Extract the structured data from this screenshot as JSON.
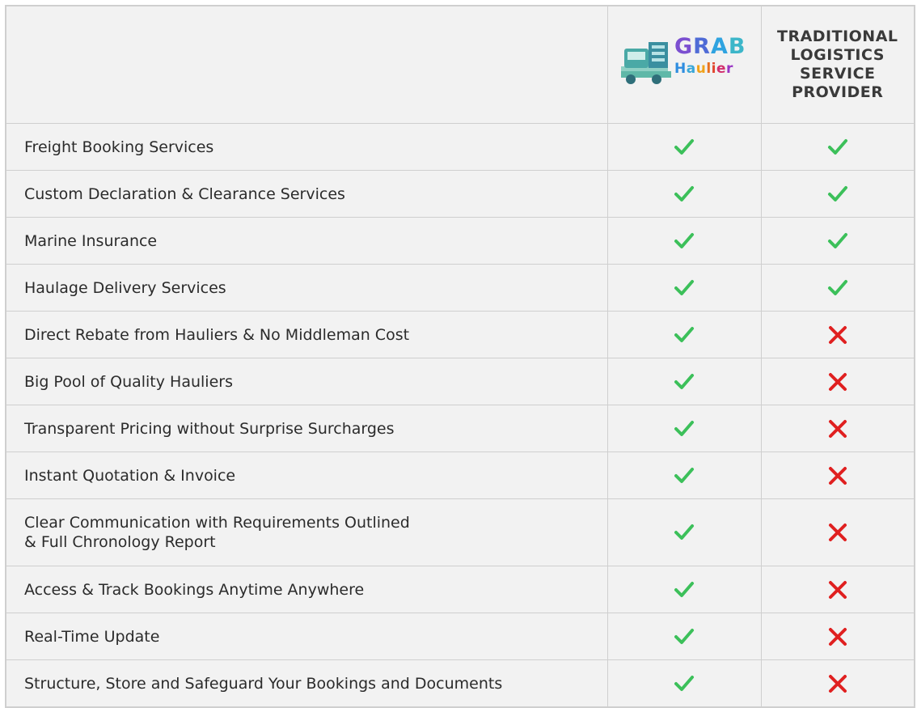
{
  "header": {
    "logo": {
      "line1": "GRAB",
      "line2": "Haulier",
      "icon": "truck-icon"
    },
    "competitor_label": "TRADITIONAL LOGISTICS SERVICE PROVIDER",
    "competitor_lines": [
      "TRADITIONAL",
      "LOGISTICS",
      "SERVICE",
      "PROVIDER"
    ]
  },
  "colors": {
    "check": "#3cc05a",
    "cross": "#e02020",
    "border": "#cfcfcf",
    "background": "#f2f2f2"
  },
  "rows": [
    {
      "feature": "Freight Booking Services",
      "grab": "check-icon",
      "traditional": "check-icon"
    },
    {
      "feature": "Custom Declaration & Clearance Services",
      "grab": "check-icon",
      "traditional": "check-icon"
    },
    {
      "feature": "Marine Insurance",
      "grab": "check-icon",
      "traditional": "check-icon"
    },
    {
      "feature": "Haulage Delivery Services",
      "grab": "check-icon",
      "traditional": "check-icon"
    },
    {
      "feature": "Direct Rebate from Hauliers & No Middleman Cost",
      "grab": "check-icon",
      "traditional": "cross-icon"
    },
    {
      "feature": "Big Pool of Quality Hauliers",
      "grab": "check-icon",
      "traditional": "cross-icon"
    },
    {
      "feature": "Transparent Pricing without Surprise Surcharges",
      "grab": "check-icon",
      "traditional": "cross-icon"
    },
    {
      "feature": "Instant Quotation & Invoice",
      "grab": "check-icon",
      "traditional": "cross-icon"
    },
    {
      "feature_lines": [
        "Clear Communication with Requirements Outlined",
        "& Full Chronology Report"
      ],
      "grab": "check-icon",
      "traditional": "cross-icon"
    },
    {
      "feature": "Access & Track Bookings Anytime Anywhere",
      "grab": "check-icon",
      "traditional": "cross-icon"
    },
    {
      "feature": "Real-Time Update",
      "grab": "check-icon",
      "traditional": "cross-icon"
    },
    {
      "feature": "Structure, Store and Safeguard Your Bookings and Documents",
      "grab": "check-icon",
      "traditional": "cross-icon"
    }
  ]
}
